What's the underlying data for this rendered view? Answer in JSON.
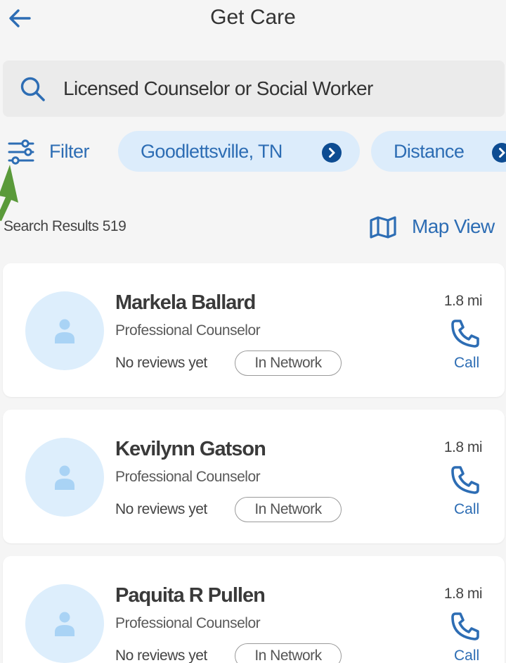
{
  "header": {
    "title": "Get Care",
    "back_icon": "arrow-left-icon"
  },
  "search": {
    "value": "Licensed Counselor or Social Worker",
    "icon": "search-icon"
  },
  "filters": {
    "filter_label": "Filter",
    "location_pill": "Goodlettsville, TN",
    "distance_pill": "Distance"
  },
  "results": {
    "label": "Search Results 519",
    "map_view_label": "Map View"
  },
  "providers": [
    {
      "name": "Markela Ballard",
      "role": "Professional Counselor",
      "reviews": "No reviews yet",
      "network": "In Network",
      "distance": "1.8 mi",
      "call": "Call"
    },
    {
      "name": "Kevilynn Gatson",
      "role": "Professional Counselor",
      "reviews": "No reviews yet",
      "network": "In Network",
      "distance": "1.8 mi",
      "call": "Call"
    },
    {
      "name": "Paquita R Pullen",
      "role": "Professional Counselor",
      "reviews": "No reviews yet",
      "network": "In Network",
      "distance": "1.8 mi",
      "call": "Call"
    }
  ],
  "colors": {
    "accent": "#2d6db4",
    "pill_bg": "#dcecfb",
    "avatar_bg": "#ddeefc",
    "annotation_arrow": "#5a9a3a"
  }
}
